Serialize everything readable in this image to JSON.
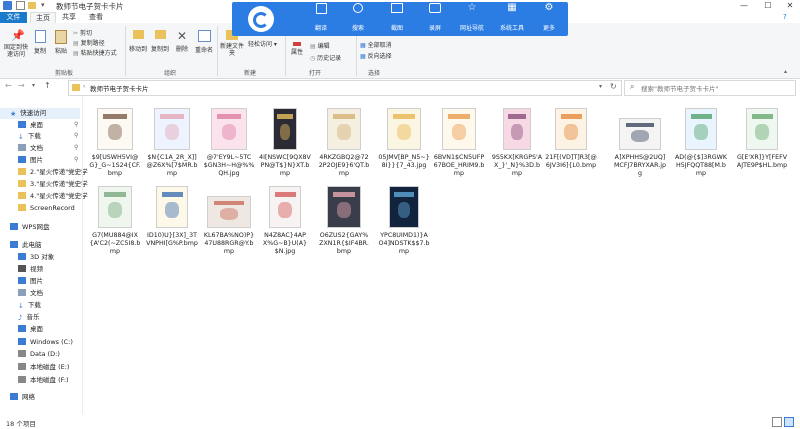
{
  "window": {
    "title": "教师节电子贺卡卡片"
  },
  "titlebar": {
    "minimize": "—",
    "maximize": "☐",
    "close": "✕"
  },
  "ribbon_tabs": [
    "文件",
    "主页",
    "共享",
    "查看"
  ],
  "ribbon": {
    "pin_label": "固定到快速访问",
    "copy_label": "复制",
    "paste_label": "粘贴",
    "cut_label": "剪切",
    "copy_path_label": "复制路径",
    "paste_shortcut_label": "粘贴快捷方式",
    "move_to_label": "移动到",
    "copy_to_label": "复制到",
    "delete_label": "删除",
    "rename_label": "重命名",
    "new_folder_label": "新建文件夹",
    "easy_access_label": "轻松访问",
    "properties_label": "属性",
    "edit_label": "编辑",
    "history_label": "历史记录",
    "select_all_label": "全部取消",
    "invert_label": "反向选择",
    "groups": [
      "剪贴板",
      "组织",
      "新建",
      "打开",
      "选择"
    ]
  },
  "wps_toolbar": {
    "items": [
      "翻译",
      "搜索",
      "截图",
      "录屏",
      "网址导航",
      "系统工具",
      "更多"
    ]
  },
  "address": {
    "path": "教师节电子贺卡卡片",
    "search_placeholder": "搜索\"教师节电子贺卡卡片\""
  },
  "nav": {
    "items": [
      "快速访问",
      "桌面",
      "下载",
      "文档",
      "图片",
      "2.\"星火传递\"党史学",
      "3.\"星火传递\"党史学",
      "4.\"星火传递\"党史学",
      "ScreenRecord",
      "WPS网盘",
      "此电脑",
      "3D 对象",
      "视频",
      "图片",
      "文档",
      "下载",
      "音乐",
      "桌面",
      "Windows (C:)",
      "Data (D:)",
      "本地磁盘 (E:)",
      "本地磁盘 (F:)",
      "网络"
    ]
  },
  "files": [
    "$9[USWH5VI@G}_G~1S24{CF.bmp",
    "$N{C1A_2R_X]]@Z6X%[7$MR.bmp",
    "@7'EY9L~5TC$GN3H~H@%%QH.jpg",
    "4I[NSWC[9QX8VPN@T$}N}XT.bmp",
    "4RKZGBQ2@722P2OJE9}6'QT.bmp",
    "05JMV[BP_N5~}8I}}{7_43.jpg",
    "6BVN1$CN5UFP67BOE_HRIM9.bmp",
    "9S5KX[KRGPS'AX_}'_N}%3D.bmp",
    "21F[(VD]T]R3[@6JV3I6]{L0.bmp",
    "A]XPHHS@2UQ]MCFJ7BRYXAR.jpg",
    "AD(@{$]3RGWKH5JFQQT88[M.bmp",
    "G[E'XR]}Y[FEFVAJTE9P$HL.bmp",
    "G7(MU884@IX{A'C2(~ZC5I8.bmp",
    "ID10)U}[3X]_3TVNPHI[G%P.bmp",
    "KL67BA%NO)P}47U88RGR@Y.bmp",
    "N4Z8AC}4APX%G~B}U(A}$N.jpg",
    "O6ZUS2{GAY%ZXN1R{$IF4BR.bmp",
    "YPC8UIMD1)}AO4]NDSTK$$7.bmp"
  ],
  "status": {
    "count": "18 个项目"
  }
}
